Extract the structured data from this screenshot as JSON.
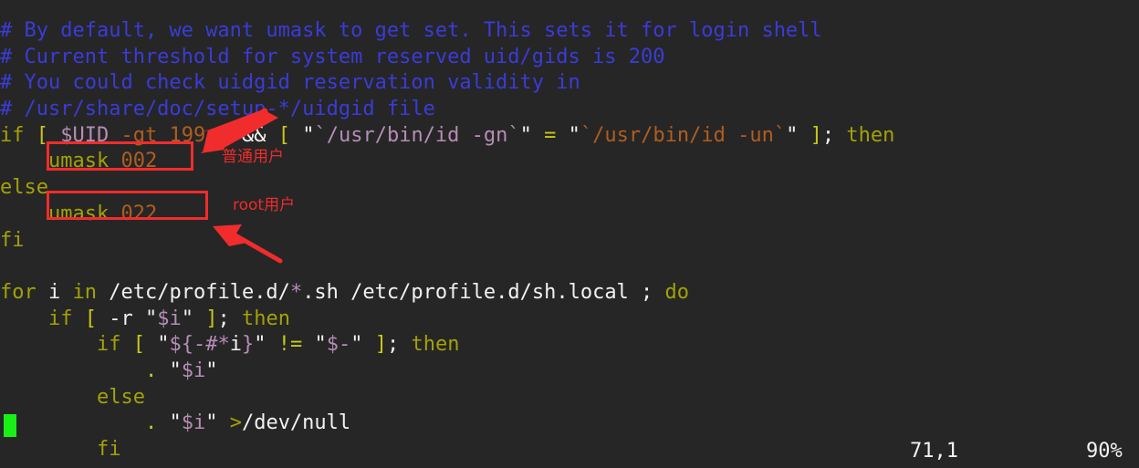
{
  "terminal": {
    "background_color": "#262626",
    "editor": "vim",
    "colors": {
      "comment": "#3b3bd9",
      "keyword": "#a2a207",
      "bracket": "#c8c817",
      "variable": "#b58db5",
      "number": "#b05d20",
      "plain_text": "#e8e8e8",
      "annotation_red": "#ef2b2b",
      "cursor_green": "#18f018"
    }
  },
  "code_lines": [
    {
      "id": "line-1",
      "text": "# By default, we want umask to get set. This sets it for login shell",
      "tokens": [
        {
          "t": "# By default, we want umask to get set. This sets it for login shell",
          "c": "c-comment"
        }
      ]
    },
    {
      "id": "line-2",
      "text": "# Current threshold for system reserved uid/gids is 200",
      "tokens": [
        {
          "t": "# Current threshold for system reserved uid/gids is 200",
          "c": "c-comment"
        }
      ]
    },
    {
      "id": "line-3",
      "text": "# You could check uidgid reservation validity in",
      "tokens": [
        {
          "t": "# You could check uidgid reservation validity in",
          "c": "c-comment"
        }
      ]
    },
    {
      "id": "line-4",
      "text": "# /usr/share/doc/setup-*/uidgid file",
      "tokens": [
        {
          "t": "# /usr/share/doc/setup-*/uidgid file",
          "c": "c-comment"
        }
      ]
    },
    {
      "id": "line-5",
      "text": "if [ $UID -gt 199 ] && [ \"`/usr/bin/id -gn`\" = \"`/usr/bin/id -un`\" ]; then",
      "tokens": [
        {
          "t": "if ",
          "c": "c-kw"
        },
        {
          "t": "[ ",
          "c": "c-bracket"
        },
        {
          "t": "$UID",
          "c": "c-var"
        },
        {
          "t": " ",
          "c": "c-plain"
        },
        {
          "t": "-gt",
          "c": "c-num"
        },
        {
          "t": " ",
          "c": "c-plain"
        },
        {
          "t": "199",
          "c": "c-num"
        },
        {
          "t": " ",
          "c": "c-plain"
        },
        {
          "t": "]",
          "c": "c-bracket"
        },
        {
          "t": " ",
          "c": "c-plain"
        },
        {
          "t": "&&",
          "c": "c-white"
        },
        {
          "t": " ",
          "c": "c-plain"
        },
        {
          "t": "[",
          "c": "c-bracket"
        },
        {
          "t": " ",
          "c": "c-plain"
        },
        {
          "t": "\"",
          "c": "c-white"
        },
        {
          "t": "`/usr/bin/id -gn`",
          "c": "c-str"
        },
        {
          "t": "\"",
          "c": "c-white"
        },
        {
          "t": " ",
          "c": "c-plain"
        },
        {
          "t": "=",
          "c": "c-op"
        },
        {
          "t": " ",
          "c": "c-plain"
        },
        {
          "t": "\"",
          "c": "c-white"
        },
        {
          "t": "`/usr/bin/id -un`",
          "c": "c-str2"
        },
        {
          "t": "\"",
          "c": "c-white"
        },
        {
          "t": " ",
          "c": "c-plain"
        },
        {
          "t": "]",
          "c": "c-bracket"
        },
        {
          "t": ";",
          "c": "c-white"
        },
        {
          "t": " ",
          "c": "c-plain"
        },
        {
          "t": "then",
          "c": "c-kw"
        }
      ]
    },
    {
      "id": "line-6",
      "text": "    umask 002",
      "tokens": [
        {
          "t": "    ",
          "c": "c-plain"
        },
        {
          "t": "umask",
          "c": "c-kw"
        },
        {
          "t": " ",
          "c": "c-plain"
        },
        {
          "t": "002",
          "c": "c-num"
        }
      ]
    },
    {
      "id": "line-7",
      "text": "else",
      "tokens": [
        {
          "t": "else",
          "c": "c-kw"
        }
      ]
    },
    {
      "id": "line-8",
      "text": "    umask 022",
      "tokens": [
        {
          "t": "    ",
          "c": "c-plain"
        },
        {
          "t": "umask",
          "c": "c-kw"
        },
        {
          "t": " ",
          "c": "c-plain"
        },
        {
          "t": "022",
          "c": "c-num"
        }
      ]
    },
    {
      "id": "line-9",
      "text": "fi",
      "tokens": [
        {
          "t": "fi",
          "c": "c-kw"
        }
      ]
    },
    {
      "id": "line-10",
      "text": "",
      "tokens": []
    },
    {
      "id": "line-11",
      "text": "for i in /etc/profile.d/*.sh /etc/profile.d/sh.local ; do",
      "tokens": [
        {
          "t": "for",
          "c": "c-kw"
        },
        {
          "t": " ",
          "c": "c-plain"
        },
        {
          "t": "i",
          "c": "c-white"
        },
        {
          "t": " ",
          "c": "c-plain"
        },
        {
          "t": "in",
          "c": "c-kw"
        },
        {
          "t": " ",
          "c": "c-plain"
        },
        {
          "t": "/etc/profile.d/",
          "c": "c-white"
        },
        {
          "t": "*",
          "c": "c-star"
        },
        {
          "t": ".sh /etc/profile.d/sh.local ;",
          "c": "c-white"
        },
        {
          "t": " ",
          "c": "c-plain"
        },
        {
          "t": "do",
          "c": "c-kw"
        }
      ]
    },
    {
      "id": "line-12",
      "text": "    if [ -r \"$i\" ]; then",
      "tokens": [
        {
          "t": "    ",
          "c": "c-plain"
        },
        {
          "t": "if",
          "c": "c-kw"
        },
        {
          "t": " ",
          "c": "c-plain"
        },
        {
          "t": "[",
          "c": "c-bracket"
        },
        {
          "t": " ",
          "c": "c-plain"
        },
        {
          "t": "-r",
          "c": "c-white"
        },
        {
          "t": " ",
          "c": "c-plain"
        },
        {
          "t": "\"",
          "c": "c-white"
        },
        {
          "t": "$i",
          "c": "c-var"
        },
        {
          "t": "\"",
          "c": "c-white"
        },
        {
          "t": " ",
          "c": "c-plain"
        },
        {
          "t": "]",
          "c": "c-bracket"
        },
        {
          "t": ";",
          "c": "c-white"
        },
        {
          "t": " ",
          "c": "c-plain"
        },
        {
          "t": "then",
          "c": "c-kw"
        }
      ]
    },
    {
      "id": "line-13",
      "text": "        if [ \"${-#*i}\" != \"$-\" ]; then",
      "tokens": [
        {
          "t": "        ",
          "c": "c-plain"
        },
        {
          "t": "if",
          "c": "c-kw"
        },
        {
          "t": " ",
          "c": "c-plain"
        },
        {
          "t": "[",
          "c": "c-bracket"
        },
        {
          "t": " ",
          "c": "c-plain"
        },
        {
          "t": "\"",
          "c": "c-white"
        },
        {
          "t": "${-#",
          "c": "c-var"
        },
        {
          "t": "*",
          "c": "c-var"
        },
        {
          "t": "i",
          "c": "c-white"
        },
        {
          "t": "}",
          "c": "c-var"
        },
        {
          "t": "\"",
          "c": "c-white"
        },
        {
          "t": " ",
          "c": "c-plain"
        },
        {
          "t": "!=",
          "c": "c-op"
        },
        {
          "t": " ",
          "c": "c-plain"
        },
        {
          "t": "\"",
          "c": "c-white"
        },
        {
          "t": "$-",
          "c": "c-var"
        },
        {
          "t": "\"",
          "c": "c-white"
        },
        {
          "t": " ",
          "c": "c-plain"
        },
        {
          "t": "]",
          "c": "c-bracket"
        },
        {
          "t": ";",
          "c": "c-white"
        },
        {
          "t": " ",
          "c": "c-plain"
        },
        {
          "t": "then",
          "c": "c-kw"
        }
      ]
    },
    {
      "id": "line-14",
      "text": "            . \"$i\"",
      "tokens": [
        {
          "t": "            ",
          "c": "c-plain"
        },
        {
          "t": ".",
          "c": "c-op"
        },
        {
          "t": " ",
          "c": "c-plain"
        },
        {
          "t": "\"",
          "c": "c-white"
        },
        {
          "t": "$i",
          "c": "c-var"
        },
        {
          "t": "\"",
          "c": "c-white"
        }
      ]
    },
    {
      "id": "line-15",
      "text": "        else",
      "tokens": [
        {
          "t": "        ",
          "c": "c-plain"
        },
        {
          "t": "else",
          "c": "c-kw"
        }
      ]
    },
    {
      "id": "line-16",
      "text": "            . \"$i\" >/dev/null",
      "tokens": [
        {
          "t": "            ",
          "c": "c-plain"
        },
        {
          "t": ".",
          "c": "c-op"
        },
        {
          "t": " ",
          "c": "c-plain"
        },
        {
          "t": "\"",
          "c": "c-white"
        },
        {
          "t": "$i",
          "c": "c-var"
        },
        {
          "t": "\"",
          "c": "c-white"
        },
        {
          "t": " ",
          "c": "c-plain"
        },
        {
          "t": ">",
          "c": "c-kw"
        },
        {
          "t": "/dev/null",
          "c": "c-white"
        }
      ]
    },
    {
      "id": "line-17",
      "text": "        fi",
      "tokens": [
        {
          "t": "        ",
          "c": "c-plain"
        },
        {
          "t": "fi",
          "c": "c-kw"
        }
      ]
    }
  ],
  "annotations": {
    "box_normal_user": {
      "label": "umask 002"
    },
    "box_root_user": {
      "label": "umask 022"
    },
    "label_normal_user": "普通用户",
    "label_root_user": "root用户"
  },
  "statusline": {
    "cursor_position": "71,1",
    "file_percent": "90%"
  }
}
